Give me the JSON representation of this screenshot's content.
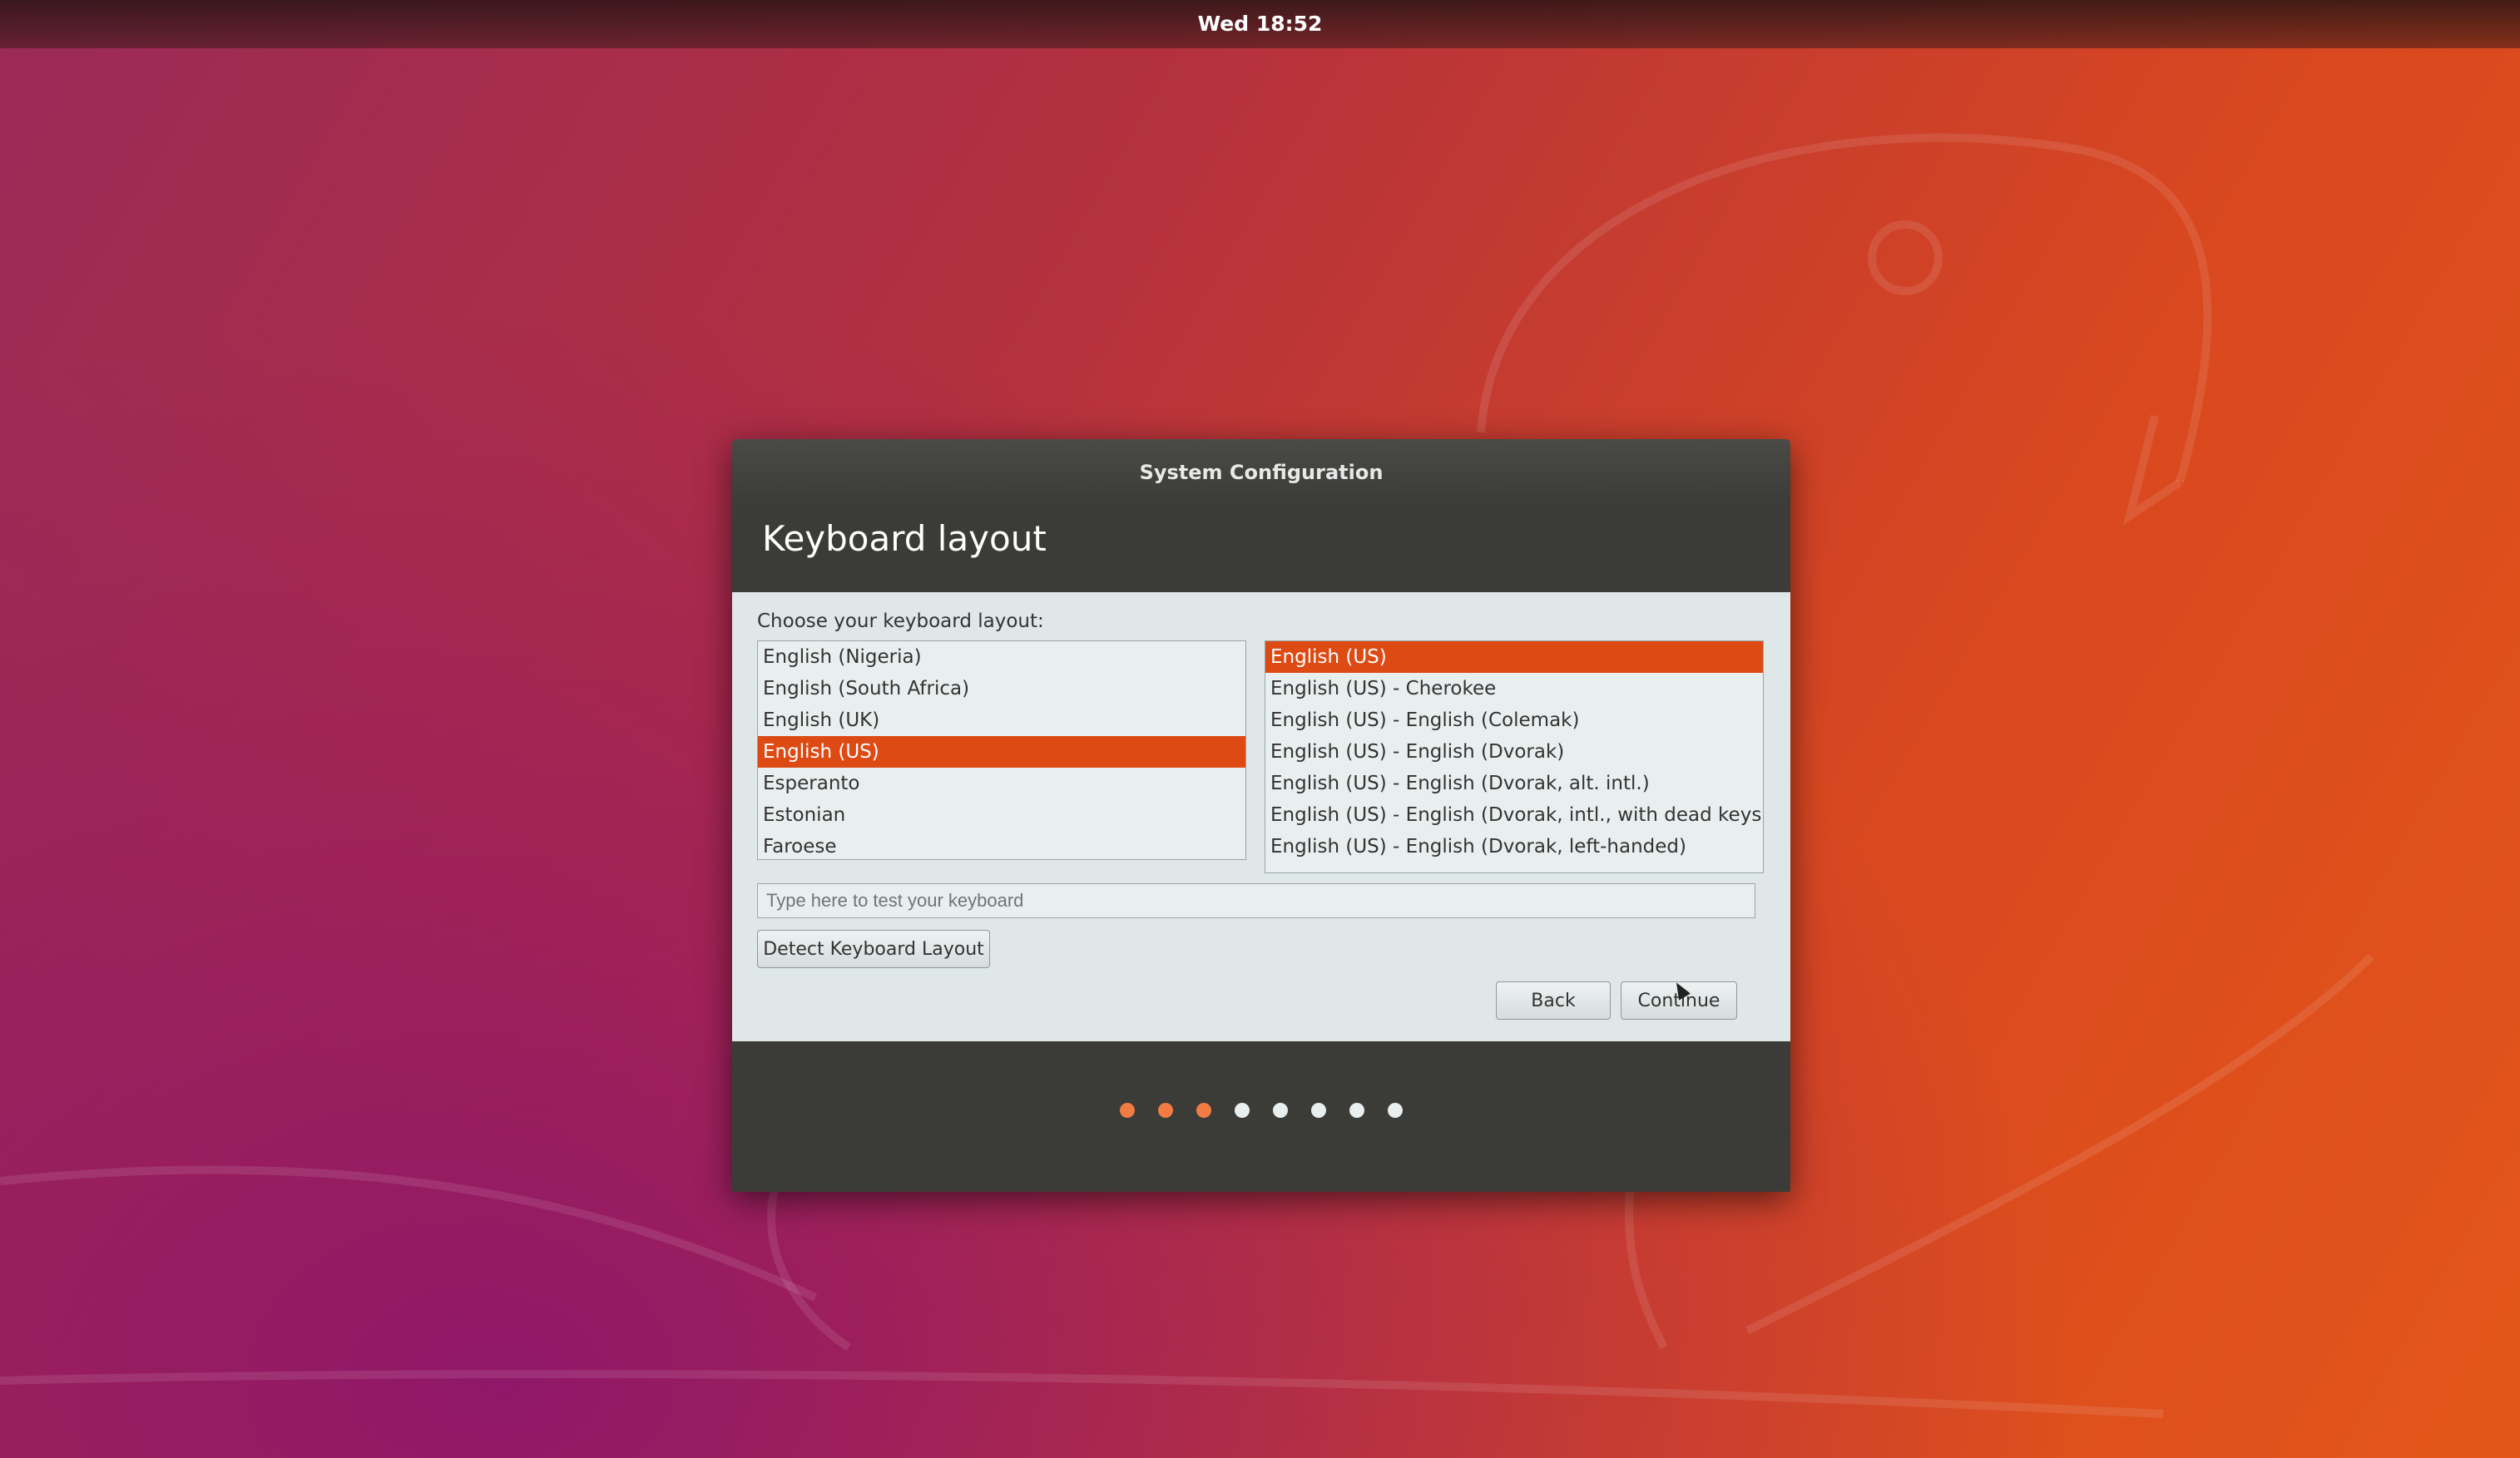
{
  "topbar": {
    "clock": "Wed 18:52"
  },
  "dialog": {
    "window_title": "System Configuration",
    "page_title": "Keyboard layout",
    "prompt": "Choose your keyboard layout:",
    "layouts": [
      {
        "label": "English (Nigeria)",
        "selected": false
      },
      {
        "label": "English (South Africa)",
        "selected": false
      },
      {
        "label": "English (UK)",
        "selected": false
      },
      {
        "label": "English (US)",
        "selected": true
      },
      {
        "label": "Esperanto",
        "selected": false
      },
      {
        "label": "Estonian",
        "selected": false
      },
      {
        "label": "Faroese",
        "selected": false
      }
    ],
    "variants": [
      {
        "label": "English (US)",
        "selected": true
      },
      {
        "label": "English (US) - Cherokee",
        "selected": false
      },
      {
        "label": "English (US) - English (Colemak)",
        "selected": false
      },
      {
        "label": "English (US) - English (Dvorak)",
        "selected": false
      },
      {
        "label": "English (US) - English (Dvorak, alt. intl.)",
        "selected": false
      },
      {
        "label": "English (US) - English (Dvorak, intl., with dead keys)",
        "selected": false
      },
      {
        "label": "English (US) - English (Dvorak, left-handed)",
        "selected": false
      }
    ],
    "test_input_placeholder": "Type here to test your keyboard",
    "detect_button": "Detect Keyboard Layout",
    "back_button": "Back",
    "continue_button": "Continue"
  },
  "progress": {
    "total_steps": 8,
    "completed_steps": 3
  },
  "colors": {
    "accent": "#dd4a14",
    "progress_done": "#f07c43",
    "progress_todo": "#e9efef",
    "dialog_frame": "#3b3c38",
    "dialog_body": "#dfe7e8"
  }
}
